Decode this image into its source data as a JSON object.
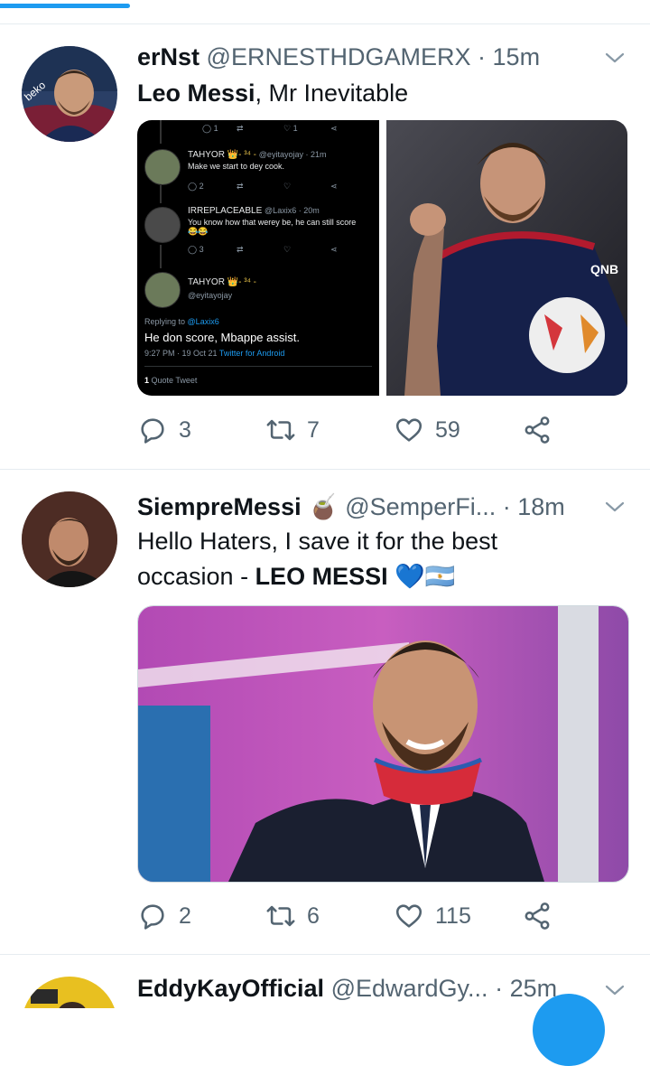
{
  "tweets": [
    {
      "name": "erNst",
      "handle": "@ERNESTHDGAMERX",
      "dot": "·",
      "time": "15m",
      "text_bold": "Leo Messi",
      "text_rest": ", Mr Inevitable",
      "quote": {
        "r1": {
          "name": "TAHYOR",
          "badge": "👑- ³⁴ -",
          "handle": "@eyitayojay · 21m",
          "text": "Make we start to dey cook."
        },
        "r2": {
          "name": "IRREPLACEABLE",
          "handle": "@Laxix6 · 20m",
          "text": "You know how that werey be, he can still score",
          "emoji": "😂😂"
        },
        "r3": {
          "name": "TAHYOR",
          "badge": "👑- ³⁴ -",
          "handle": "@eyitayojay"
        },
        "replying_to": "Replying to",
        "replying_handle": "@Laxix6",
        "main_text": "He don score, Mbappe assist.",
        "meta_time": "9:27 PM · 19 Oct 21",
        "meta_source": "Twitter for Android",
        "quote_count": "1",
        "quote_label": "Quote Tweet",
        "stats": {
          "a": "1",
          "b": "1",
          "c": "2"
        }
      },
      "replies": "3",
      "retweets": "7",
      "likes": "59"
    },
    {
      "name": "SiempreMessi",
      "emoji": "🧉",
      "handle": "@SemperFi...",
      "dot": "·",
      "time": "18m",
      "text_line1": "Hello Haters, I save it for the best",
      "text_line2": "occasion - ",
      "text_bold": "LEO MESSI",
      "text_emoji": "💙🇦🇷",
      "replies": "2",
      "retweets": "6",
      "likes": "115"
    },
    {
      "name": "EddyKayOfficial",
      "handle": "@EdwardGy...",
      "dot": "·",
      "time": "25m"
    }
  ]
}
